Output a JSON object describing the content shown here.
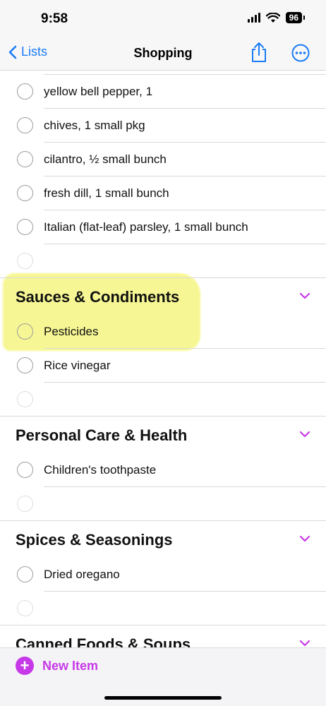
{
  "status_bar": {
    "time": "9:58",
    "battery": "96"
  },
  "nav": {
    "back_label": "Lists",
    "title": "Shopping"
  },
  "sections": [
    {
      "title": "",
      "items": [
        "yellow bell pepper, 1",
        "chives, 1 small pkg",
        "cilantro, ½ small bunch",
        "fresh dill, 1 small bunch",
        "Italian (flat-leaf) parsley, 1 small bunch"
      ]
    },
    {
      "title": "Sauces & Condiments",
      "items": [
        "Pesticides",
        "Rice vinegar"
      ]
    },
    {
      "title": "Personal Care & Health",
      "items": [
        "Children's toothpaste"
      ]
    },
    {
      "title": "Spices & Seasonings",
      "items": [
        "Dried oregano"
      ]
    },
    {
      "title": "Canned Foods & Soups",
      "items": []
    }
  ],
  "bottom": {
    "new_item_label": "New Item"
  },
  "colors": {
    "accent": "#c739e8",
    "link": "#1a7cf5",
    "highlight": "#f5f57a"
  }
}
